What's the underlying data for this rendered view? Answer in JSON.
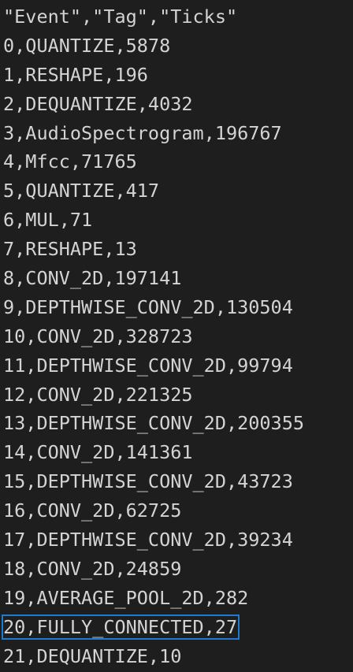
{
  "csv": {
    "header": "\"Event\",\"Tag\",\"Ticks\"",
    "rows": [
      "0,QUANTIZE,5878",
      "1,RESHAPE,196",
      "2,DEQUANTIZE,4032",
      "3,AudioSpectrogram,196767",
      "4,Mfcc,71765",
      "5,QUANTIZE,417",
      "6,MUL,71",
      "7,RESHAPE,13",
      "8,CONV_2D,197141",
      "9,DEPTHWISE_CONV_2D,130504",
      "10,CONV_2D,328723",
      "11,DEPTHWISE_CONV_2D,99794",
      "12,CONV_2D,221325",
      "13,DEPTHWISE_CONV_2D,200355",
      "14,CONV_2D,141361",
      "15,DEPTHWISE_CONV_2D,43723",
      "16,CONV_2D,62725",
      "17,DEPTHWISE_CONV_2D,39234",
      "18,CONV_2D,24859",
      "19,AVERAGE_POOL_2D,282",
      "20,FULLY_CONNECTED,27",
      "21,DEQUANTIZE,10"
    ],
    "highlighted_row_index": 20
  },
  "colors": {
    "background": "#1e1e1e",
    "text": "#d4d4d4",
    "highlight_border": "#1f7ad1"
  }
}
